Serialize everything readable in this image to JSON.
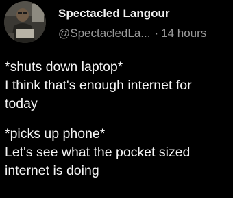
{
  "tweet": {
    "author": {
      "display_name": "Spectacled Langour",
      "handle": "@SpectacledLa...",
      "separator": "·",
      "timestamp": "14 hours"
    },
    "avatar_icon": "profile-photo",
    "paragraphs": [
      {
        "lines": [
          "*shuts down laptop*",
          "I think that's enough internet for",
          "today"
        ]
      },
      {
        "lines": [
          "*picks up phone*",
          "Let's see what the pocket sized",
          "internet is doing"
        ]
      }
    ]
  },
  "colors": {
    "background": "#000000",
    "name_text": "#f2f2f2",
    "meta_text": "#9a9a9a",
    "body_text": "#f5f5f5"
  }
}
